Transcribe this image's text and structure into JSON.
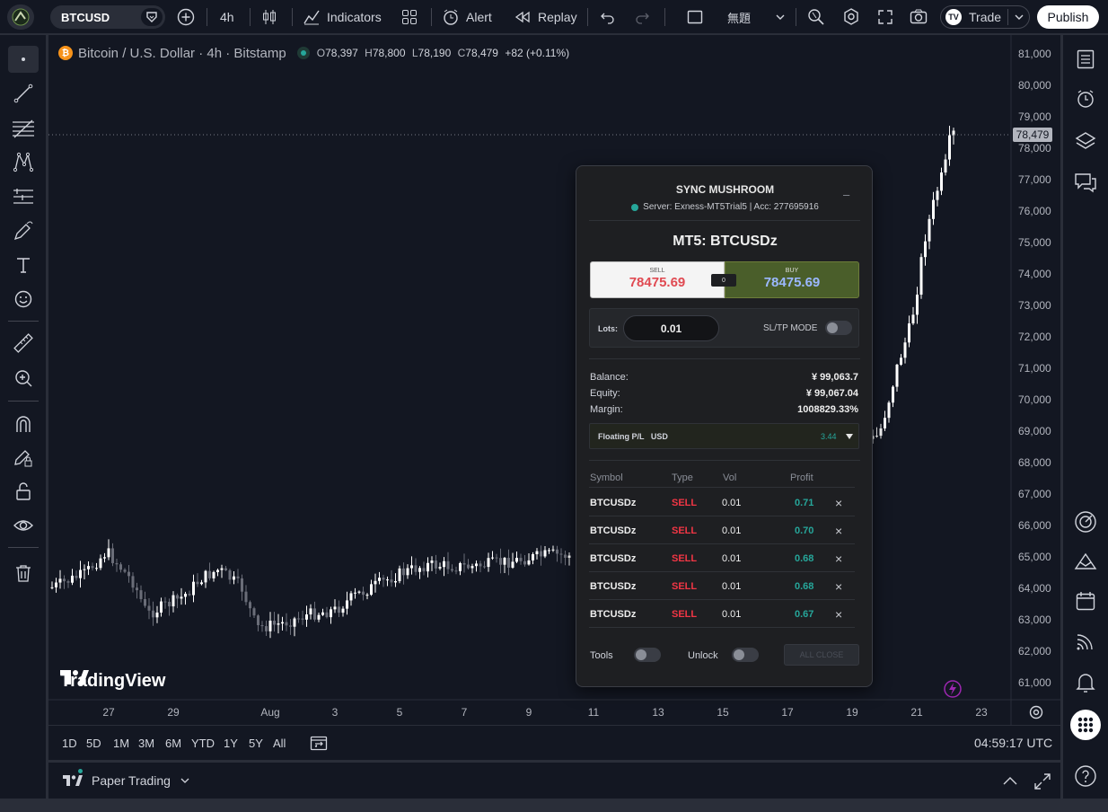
{
  "topbar": {
    "symbol": "BTCUSD",
    "interval": "4h",
    "indicators_label": "Indicators",
    "alert_label": "Alert",
    "replay_label": "Replay",
    "layout_name": "無題",
    "trade_label": "Trade",
    "publish_label": "Publish"
  },
  "legend": {
    "title": "Bitcoin / U.S. Dollar · 4h · Bitstamp",
    "o_label": "O",
    "o_value": "78,397",
    "h_label": "H",
    "h_value": "78,800",
    "l_label": "L",
    "l_value": "78,190",
    "c_label": "C",
    "c_value": "78,479",
    "change": "+82 (+0.11%)"
  },
  "price_axis": {
    "labels": [
      "81,000",
      "80,000",
      "79,000",
      "78,000",
      "77,000",
      "76,000",
      "75,000",
      "74,000",
      "73,000",
      "72,000",
      "71,000",
      "70,000",
      "69,000",
      "68,000",
      "67,000",
      "66,000",
      "65,000",
      "64,000",
      "63,000",
      "62,000",
      "61,000"
    ],
    "last_price": "78,479"
  },
  "time_axis": {
    "labels": [
      "27",
      "29",
      "Aug",
      "3",
      "5",
      "7",
      "9",
      "11",
      "13",
      "15",
      "17",
      "19",
      "21",
      "23"
    ]
  },
  "watermark": "TradingView",
  "colors": {
    "up": "#ffffff",
    "down": "#5d606b",
    "accent": "#2962ff",
    "sell": "#f23645",
    "profit": "#26a69a",
    "buy_bg": "#4a5e2a"
  },
  "range_bar": {
    "ranges": [
      "1D",
      "5D",
      "1M",
      "3M",
      "6M",
      "YTD",
      "1Y",
      "5Y",
      "All"
    ],
    "clock": "04:59:17 UTC"
  },
  "bottom_panel": {
    "tab_label": "Paper Trading"
  },
  "sync_panel": {
    "title": "SYNC MUSHROOM",
    "minimize": "–",
    "server": "Server: Exness-MT5Trial5 | Acc: 277695916",
    "instrument": "MT5: BTCUSDz",
    "sell_label": "SELL",
    "sell_price": "78475.69",
    "spread": "0",
    "buy_label": "BUY",
    "buy_price": "78475.69",
    "lots_label": "Lots:",
    "lots_value": "0.01",
    "sltp_label": "SL/TP MODE",
    "balance_label": "Balance:",
    "balance_value": "¥ 99,063.7",
    "equity_label": "Equity:",
    "equity_value": "¥ 99,067.04",
    "margin_label": "Margin:",
    "margin_value": "1008829.33%",
    "floating_label": "Floating P/L   USD",
    "floating_value": "3.44",
    "headers": {
      "symbol": "Symbol",
      "type": "Type",
      "vol": "Vol",
      "profit": "Profit"
    },
    "orders": [
      {
        "symbol": "BTCUSDz",
        "type": "SELL",
        "vol": "0.01",
        "profit": "0.71"
      },
      {
        "symbol": "BTCUSDz",
        "type": "SELL",
        "vol": "0.01",
        "profit": "0.70"
      },
      {
        "symbol": "BTCUSDz",
        "type": "SELL",
        "vol": "0.01",
        "profit": "0.68"
      },
      {
        "symbol": "BTCUSDz",
        "type": "SELL",
        "vol": "0.01",
        "profit": "0.68"
      },
      {
        "symbol": "BTCUSDz",
        "type": "SELL",
        "vol": "0.01",
        "profit": "0.67"
      }
    ],
    "close_icon": "×",
    "tools_label": "Tools",
    "unlock_label": "Unlock",
    "all_close_label": "ALL CLOSE"
  }
}
